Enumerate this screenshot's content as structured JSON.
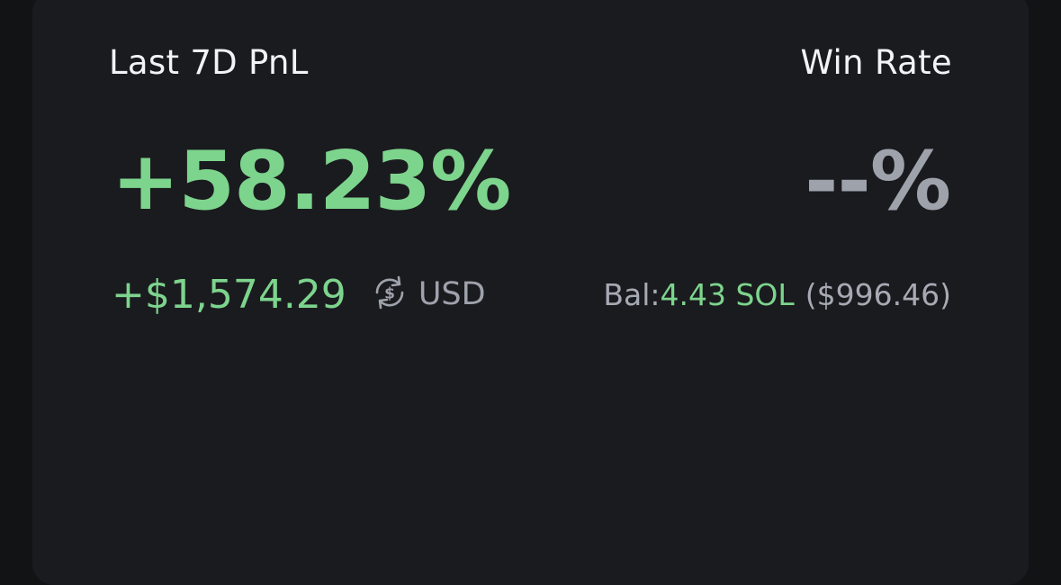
{
  "pnl": {
    "label": "Last 7D PnL",
    "percent": "+58.23%",
    "amount": "+$1,574.29",
    "currency": "USD",
    "currency_icon": "currency-swap-icon"
  },
  "win_rate": {
    "label": "Win Rate",
    "value": "--%"
  },
  "balance": {
    "label": "Bal:",
    "sol": "4.43 SOL",
    "usd": "($996.46)"
  },
  "colors": {
    "background": "#121315",
    "card": "#1a1b1f",
    "positive": "#7dd48d",
    "muted": "#9ea2ab",
    "text": "#f2f3f5"
  }
}
